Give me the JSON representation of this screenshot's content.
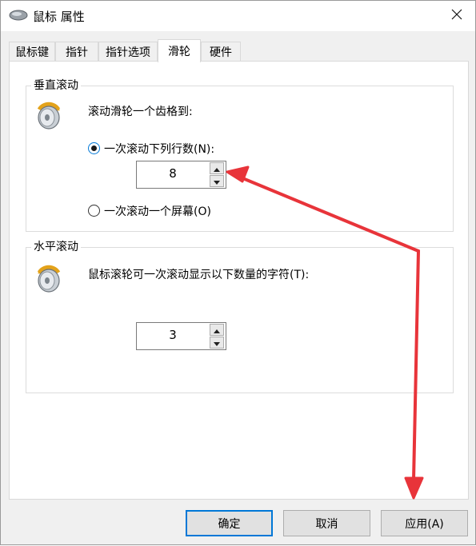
{
  "window": {
    "title": "鼠标 属性"
  },
  "tabs": [
    {
      "label": "鼠标键",
      "active": false
    },
    {
      "label": "指针",
      "active": false
    },
    {
      "label": "指针选项",
      "active": false
    },
    {
      "label": "滑轮",
      "active": true
    },
    {
      "label": "硬件",
      "active": false
    }
  ],
  "vertical": {
    "legend": "垂直滚动",
    "description": "滚动滑轮一个齿格到:",
    "option_lines": {
      "label": "一次滚动下列行数(N):",
      "checked": true
    },
    "lines_value": "8",
    "option_screen": {
      "label": "一次滚动一个屏幕(O)",
      "checked": false
    }
  },
  "horizontal": {
    "legend": "水平滚动",
    "description": "鼠标滚轮可一次滚动显示以下数量的字符(T):",
    "chars_value": "3"
  },
  "buttons": {
    "ok": "确定",
    "cancel": "取消",
    "apply": "应用(A)"
  },
  "icons": {
    "title": "mouse-icon",
    "wheel": "mouse-wheel-icon",
    "close": "close-icon",
    "spin_up": "spin-up-icon",
    "spin_down": "spin-down-icon"
  },
  "colors": {
    "accent": "#0078d7",
    "annotation": "#e8343a"
  }
}
